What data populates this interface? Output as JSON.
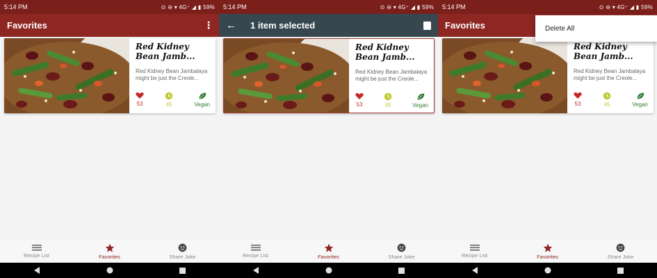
{
  "status_bar": {
    "time": "5:14 PM",
    "indicators": "⊙ ⊖ ▾ 4G⁺ ◢ ▮ 59%"
  },
  "screens": [
    {
      "app_bar": {
        "title": "Favorites",
        "overflow_icon": "more-vert-icon"
      },
      "card": {
        "title": "Red Kidney Bean Jamb...",
        "description": "Red Kidney Bean Jambalaya might be just the Creole...",
        "likes": "53",
        "minutes": "45",
        "diet": "Vegan",
        "selected": false
      }
    },
    {
      "app_bar": {
        "title": "1 item selected",
        "back_icon": "arrow-back-icon",
        "delete_icon": "delete-icon"
      },
      "card": {
        "title": "Red Kidney Bean Jamb...",
        "description": "Red Kidney Bean Jambalaya might be just the Creole...",
        "likes": "53",
        "minutes": "45",
        "diet": "Vegan",
        "selected": true
      }
    },
    {
      "app_bar": {
        "title": "Favorites"
      },
      "menu": {
        "delete_all": "Delete All"
      },
      "card": {
        "title": "Red Kidney Bean Jamb...",
        "description": "Red Kidney Bean Jambalaya might be just the Creole...",
        "likes": "53",
        "minutes": "45",
        "diet": "Vegan",
        "selected": false
      }
    }
  ],
  "bottom_nav": [
    {
      "label": "Recipe List",
      "icon": "list-icon",
      "active": false
    },
    {
      "label": "Favorites",
      "icon": "star-icon",
      "active": true
    },
    {
      "label": "Share Joke",
      "icon": "smiley-icon",
      "active": false
    }
  ],
  "system_nav": {
    "back": "back-triangle-icon",
    "home": "home-circle-icon",
    "recents": "recents-square-icon"
  },
  "colors": {
    "app_bar": "#8e2622",
    "status_bar": "#7b1f1b",
    "action_mode_bar": "#37474f",
    "like_red": "#c62828",
    "time_yellow": "#c0ca33",
    "vegan_green": "#2e7d32"
  }
}
